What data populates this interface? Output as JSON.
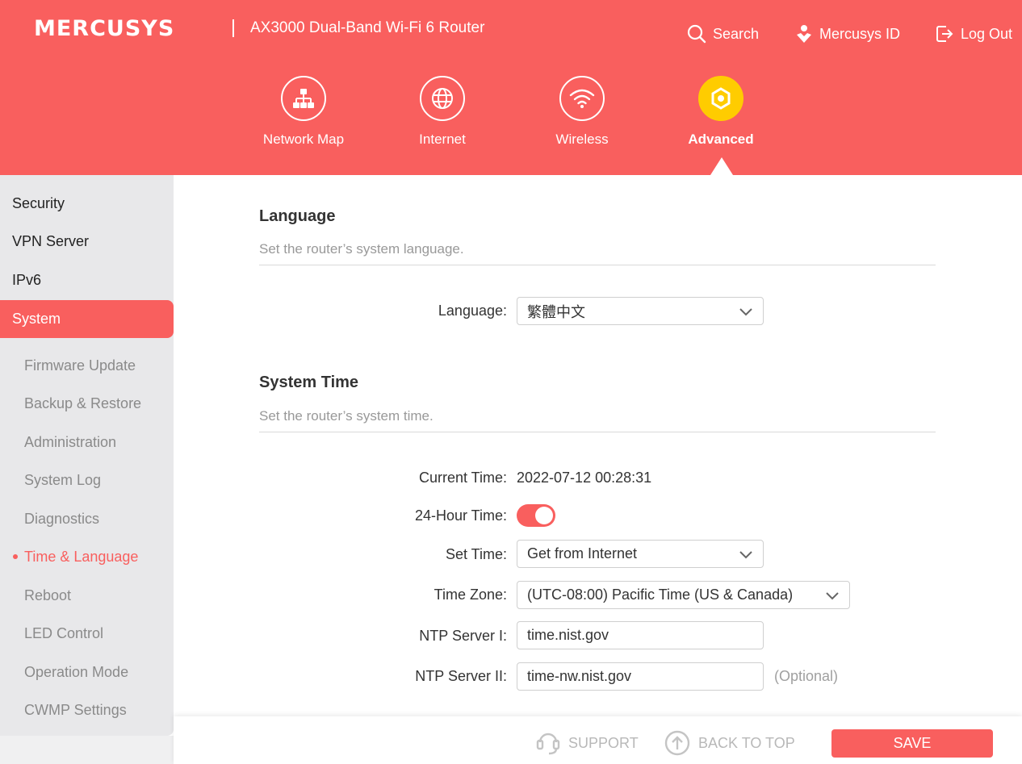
{
  "header": {
    "brand": "MERCUSYS",
    "product": "AX3000 Dual-Band Wi-Fi 6 Router",
    "links": {
      "search": "Search",
      "mercusys_id": "Mercusys ID",
      "logout": "Log Out"
    },
    "nav": [
      "Network Map",
      "Internet",
      "Wireless",
      "Advanced"
    ],
    "active_nav": "Advanced"
  },
  "sidebar": {
    "items": [
      "Security",
      "VPN Server",
      "IPv6",
      "System"
    ],
    "active_item": "System",
    "sub_items": [
      "Firmware Update",
      "Backup & Restore",
      "Administration",
      "System Log",
      "Diagnostics",
      "Time & Language",
      "Reboot",
      "LED Control",
      "Operation Mode",
      "CWMP Settings"
    ],
    "active_sub_item": "Time & Language"
  },
  "language_section": {
    "title": "Language",
    "description": "Set the router’s system language.",
    "label": "Language:",
    "value": "繁體中文"
  },
  "system_time": {
    "title": "System Time",
    "description": "Set the router’s system time.",
    "current_time_label": "Current Time:",
    "current_time_value": "2022-07-12 00:28:31",
    "hour24_label": "24-Hour Time:",
    "hour24_enabled": true,
    "set_time_label": "Set Time:",
    "set_time_value": "Get from Internet",
    "timezone_label": "Time Zone:",
    "timezone_value": "(UTC-08:00) Pacific Time (US & Canada)",
    "ntp1_label": "NTP Server I:",
    "ntp1_value": "time.nist.gov",
    "ntp2_label": "NTP Server II:",
    "ntp2_value": "time-nw.nist.gov",
    "optional_text": "(Optional)"
  },
  "footer": {
    "support": "SUPPORT",
    "back_to_top": "BACK TO TOP",
    "save": "SAVE"
  },
  "colors": {
    "brand": "#f95f5e",
    "active_icon": "#ffcc00",
    "sidebar_bg": "#e8e8ea"
  }
}
